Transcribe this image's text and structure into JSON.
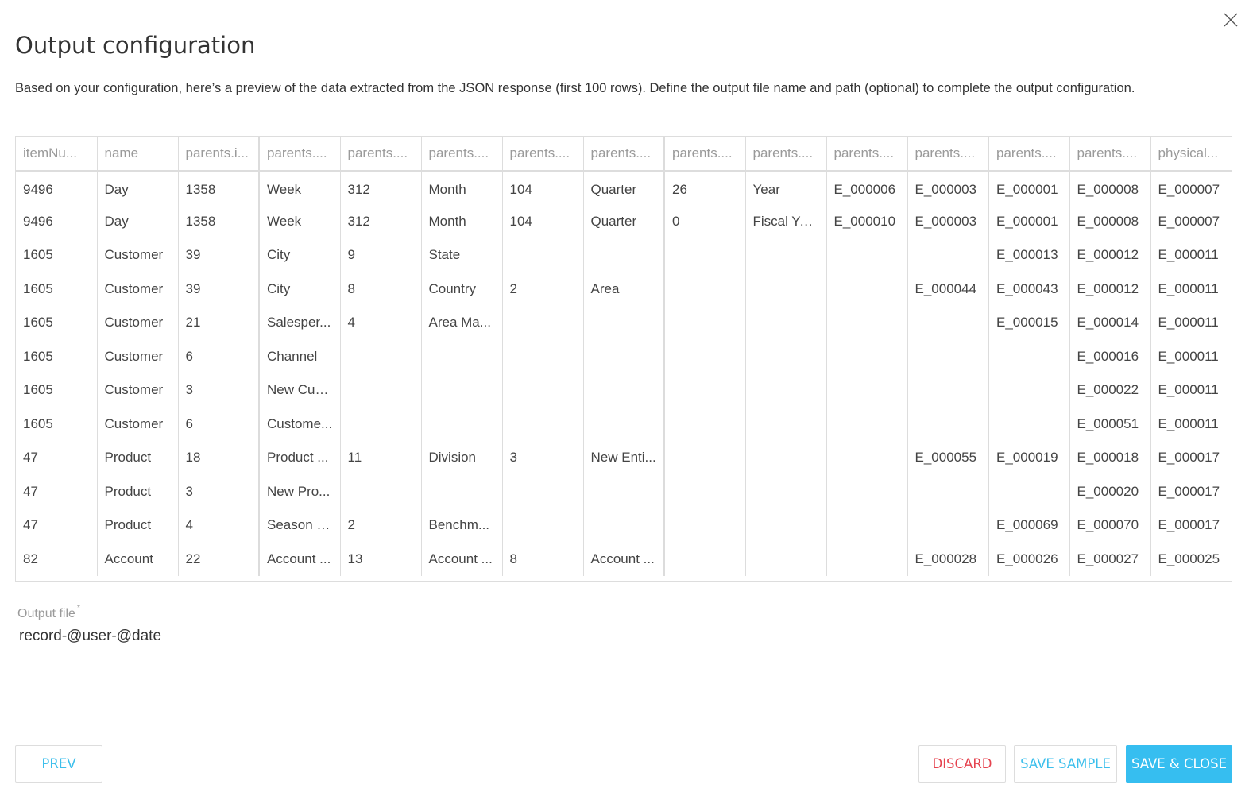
{
  "dialog": {
    "title": "Output configuration",
    "description": "Based on your configuration, here’s a preview of the data extracted from the JSON response (first 100 rows). Define the output file name and path (optional) to complete the output configuration.",
    "close_icon": "close-icon"
  },
  "table": {
    "columns": [
      "itemNu...",
      "name",
      "parents.i...",
      "parents....",
      "parents....",
      "parents....",
      "parents....",
      "parents....",
      "parents....",
      "parents....",
      "parents....",
      "parents....",
      "parents....",
      "parents....",
      "physical..."
    ],
    "rows": [
      [
        "9496",
        "Day",
        "1358",
        "Week",
        "312",
        "Month",
        "104",
        "Quarter",
        "26",
        "Year",
        "E_000006",
        "E_000003",
        "E_000001",
        "E_000008",
        "E_000007"
      ],
      [
        "9496",
        "Day",
        "1358",
        "Week",
        "312",
        "Month",
        "104",
        "Quarter",
        "0",
        "Fiscal Year",
        "E_000010",
        "E_000003",
        "E_000001",
        "E_000008",
        "E_000007"
      ],
      [
        "1605",
        "Customer",
        "39",
        "City",
        "9",
        "State",
        "",
        "",
        "",
        "",
        "",
        "",
        "E_000013",
        "E_000012",
        "E_000011"
      ],
      [
        "1605",
        "Customer",
        "39",
        "City",
        "8",
        "Country",
        "2",
        "Area",
        "",
        "",
        "",
        "E_000044",
        "E_000043",
        "E_000012",
        "E_000011"
      ],
      [
        "1605",
        "Customer",
        "21",
        "Salesper...",
        "4",
        "Area Ma...",
        "",
        "",
        "",
        "",
        "",
        "",
        "E_000015",
        "E_000014",
        "E_000011"
      ],
      [
        "1605",
        "Customer",
        "6",
        "Channel",
        "",
        "",
        "",
        "",
        "",
        "",
        "",
        "",
        "",
        "E_000016",
        "E_000011"
      ],
      [
        "1605",
        "Customer",
        "3",
        "New Cus...",
        "",
        "",
        "",
        "",
        "",
        "",
        "",
        "",
        "",
        "E_000022",
        "E_000011"
      ],
      [
        "1605",
        "Customer",
        "6",
        "Custome...",
        "",
        "",
        "",
        "",
        "",
        "",
        "",
        "",
        "",
        "E_000051",
        "E_000011"
      ],
      [
        "47",
        "Product",
        "18",
        "Product ...",
        "11",
        "Division",
        "3",
        "New Enti...",
        "",
        "",
        "",
        "E_000055",
        "E_000019",
        "E_000018",
        "E_000017"
      ],
      [
        "47",
        "Product",
        "3",
        "New Pro...",
        "",
        "",
        "",
        "",
        "",
        "",
        "",
        "",
        "",
        "E_000020",
        "E_000017"
      ],
      [
        "47",
        "Product",
        "4",
        "Season P...",
        "2",
        "Benchm...",
        "",
        "",
        "",
        "",
        "",
        "",
        "E_000069",
        "E_000070",
        "E_000017"
      ],
      [
        "82",
        "Account",
        "22",
        "Account ...",
        "13",
        "Account ...",
        "8",
        "Account ...",
        "",
        "",
        "",
        "E_000028",
        "E_000026",
        "E_000027",
        "E_000025"
      ]
    ]
  },
  "output_file": {
    "label": "Output file",
    "required_marker": "*",
    "value": "record-@user-@date"
  },
  "buttons": {
    "prev": "PREV",
    "discard": "DISCARD",
    "save_sample": "SAVE SAMPLE",
    "save_close": "SAVE & CLOSE"
  },
  "colors": {
    "accent": "#36bef0",
    "danger": "#e5434f",
    "border": "#dddddd",
    "header_text": "#9a9a9a"
  }
}
